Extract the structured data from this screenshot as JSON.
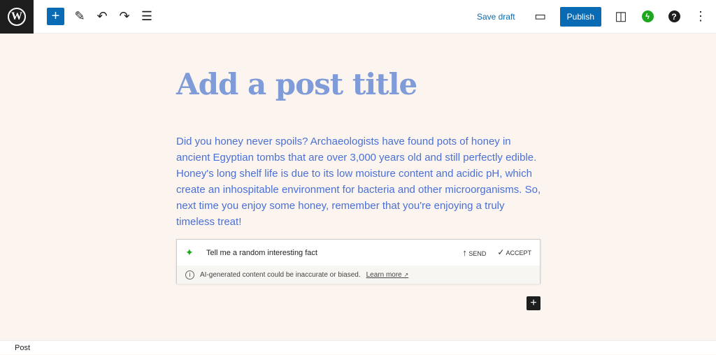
{
  "toolbar": {
    "logo": "W",
    "save_draft": "Save draft",
    "publish": "Publish",
    "icons": [
      "wordpress-logo",
      "plus-icon",
      "pencil-icon",
      "undo-icon",
      "redo-icon",
      "list-view-icon",
      "preview-laptop-icon",
      "sidebar-icon",
      "jetpack-icon",
      "help-icon",
      "more-vertical-icon"
    ]
  },
  "editor": {
    "title_placeholder": "Add a post title",
    "paragraph": "Did you honey never spoils? Archaeologists have found pots of honey in ancient Egyptian tombs that are over 3,000 years old and still perfectly edible. Honey's long shelf life is due to its low moisture content and acidic pH, which create an inhospitable environment for bacteria and other microorganisms. So, next time you enjoy some honey, remember that you're enjoying a truly timeless treat!"
  },
  "ai": {
    "prompt": "Tell me a random interesting fact",
    "send": "SEND",
    "accept": "ACCEPT",
    "disclaimer": "AI-generated content could be inaccurate or biased.",
    "learn_more": "Learn more"
  },
  "footer": {
    "breadcrumb": "Post"
  },
  "colors": {
    "accent": "#0a6bb5",
    "jetpack": "#1ea61e",
    "text": "#4a6fd6",
    "background": "#fcf5ef"
  }
}
